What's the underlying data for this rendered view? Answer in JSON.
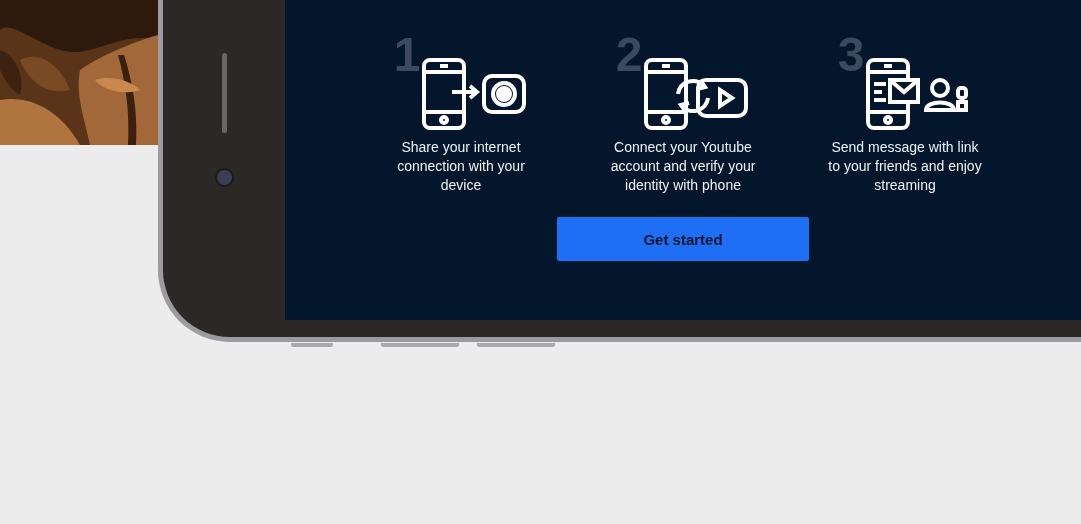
{
  "steps": [
    {
      "number": "1",
      "kind": "share",
      "text": "Share your internet connection with your device"
    },
    {
      "number": "2",
      "kind": "connect",
      "text": "Connect your Youtube account and verify your identity with phone"
    },
    {
      "number": "3",
      "kind": "message",
      "text": "Send message with link to your friends and enjoy streaming"
    }
  ],
  "button": {
    "label": "Get started"
  }
}
